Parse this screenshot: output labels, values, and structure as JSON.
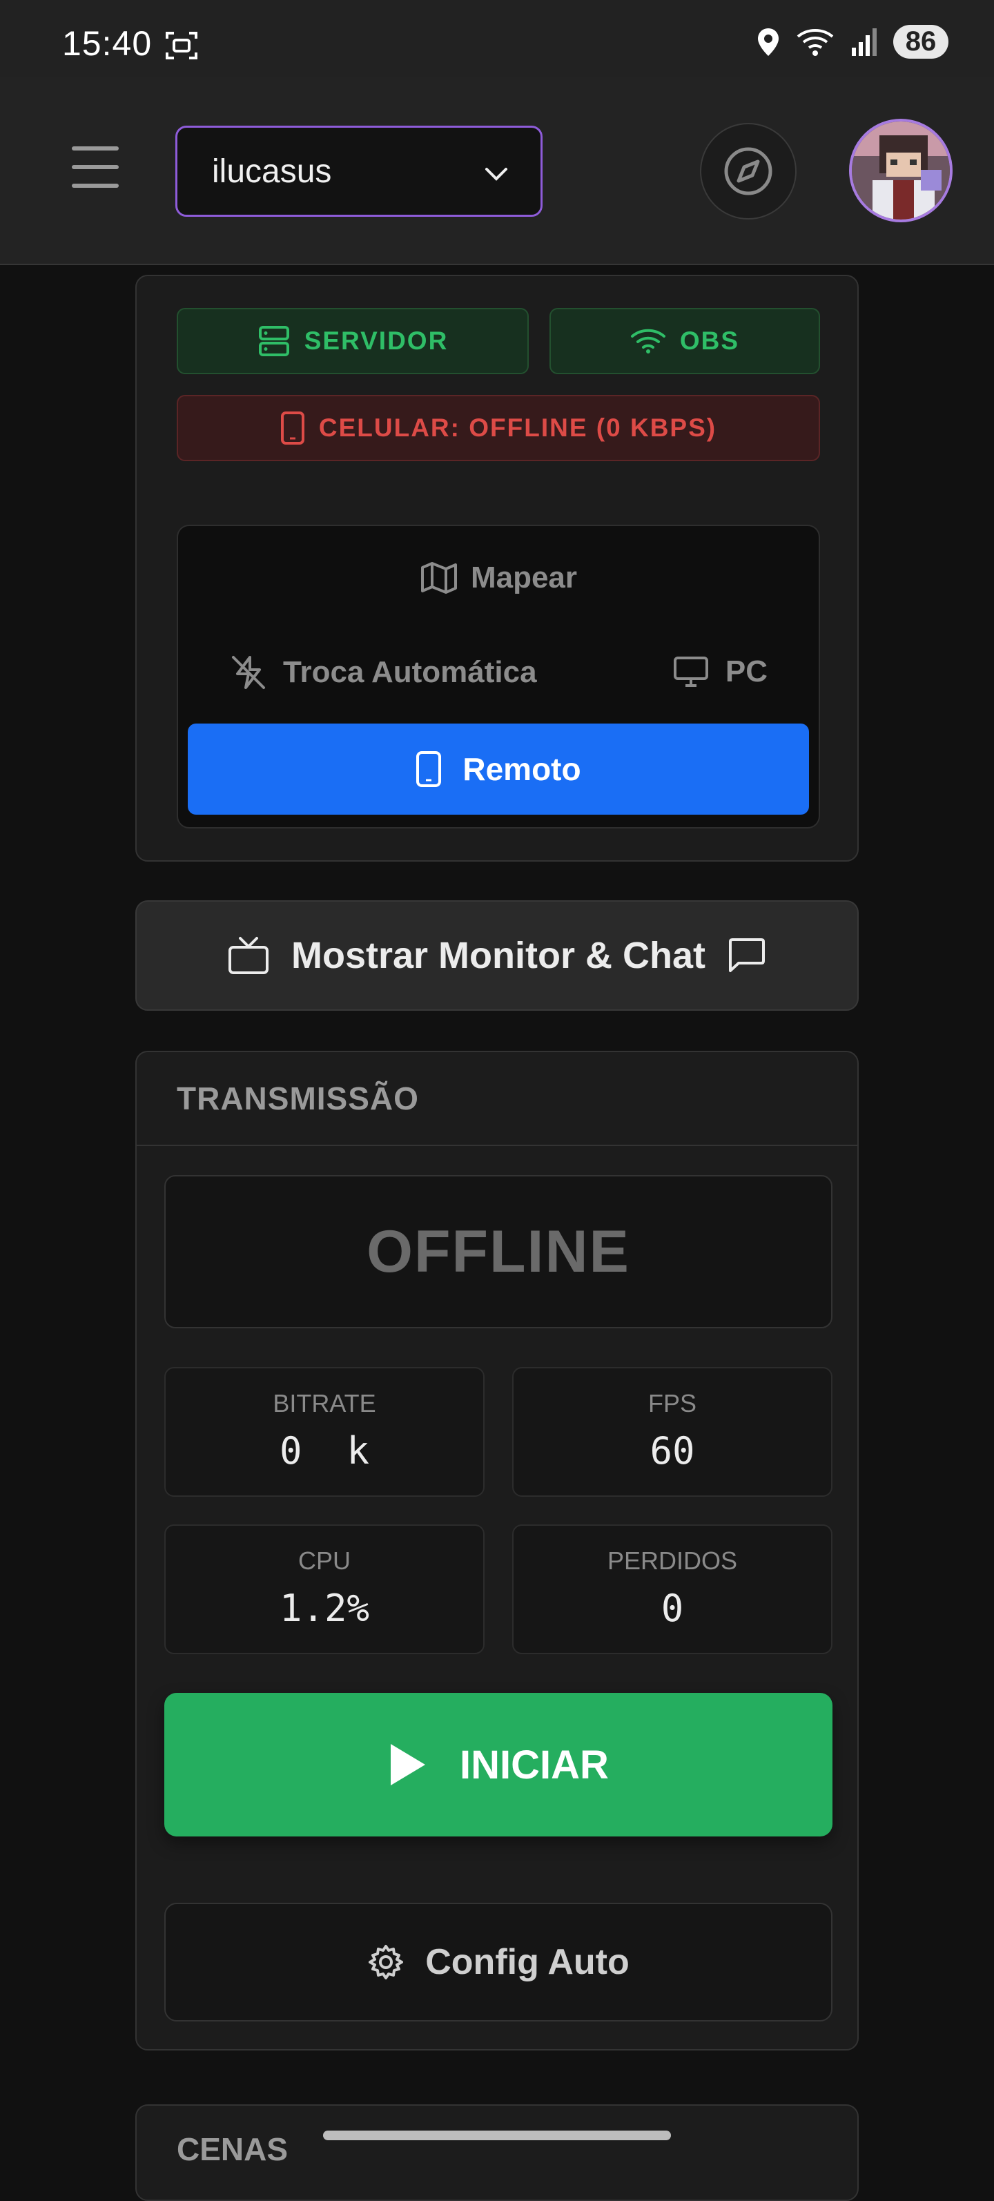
{
  "status_bar": {
    "time": "15:40",
    "battery": "86"
  },
  "header": {
    "account": "ilucasus"
  },
  "connections": {
    "server_label": "SERVIDOR",
    "obs_label": "OBS",
    "phone_label": "CELULAR: OFFLINE (0 KBPS)"
  },
  "switcher": {
    "map_label": "Mapear",
    "auto_label": "Troca Automática",
    "pc_label": "PC",
    "remote_label": "Remoto"
  },
  "monitor_button_label": "Mostrar Monitor & Chat",
  "transmission": {
    "title": "TRANSMISSÃO",
    "status": "OFFLINE",
    "stats": [
      {
        "label": "BITRATE",
        "value": "0  k"
      },
      {
        "label": "FPS",
        "value": "60"
      },
      {
        "label": "CPU",
        "value": "1.2%"
      },
      {
        "label": "PERDIDOS",
        "value": "0"
      }
    ],
    "start_label": "INICIAR",
    "config_label": "Config Auto"
  },
  "next_section_title": "CENAS",
  "colors": {
    "accent_purple": "#8e5cd9",
    "ok_green": "#2fbe67",
    "error_red": "#dd4b47",
    "primary_blue": "#1a6ef5",
    "start_green": "#25ae5f"
  }
}
